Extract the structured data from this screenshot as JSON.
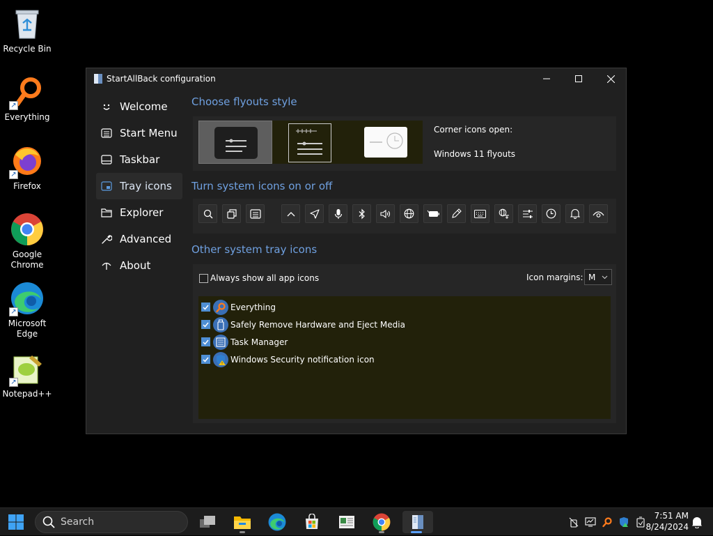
{
  "desktop": {
    "icons": [
      {
        "name": "recycle-bin",
        "label": "Recycle Bin"
      },
      {
        "name": "everything",
        "label": "Everything"
      },
      {
        "name": "firefox",
        "label": "Firefox"
      },
      {
        "name": "google-chrome",
        "label": "Google Chrome"
      },
      {
        "name": "microsoft-edge",
        "label": "Microsoft Edge"
      },
      {
        "name": "notepad-plus-plus",
        "label": "Notepad++"
      }
    ]
  },
  "window": {
    "title": "StartAllBack configuration",
    "nav": [
      {
        "label": "Welcome",
        "icon": "smiley-icon"
      },
      {
        "label": "Start Menu",
        "icon": "start-menu-icon"
      },
      {
        "label": "Taskbar",
        "icon": "taskbar-icon"
      },
      {
        "label": "Tray icons",
        "icon": "tray-icon",
        "active": true
      },
      {
        "label": "Explorer",
        "icon": "folder-icon"
      },
      {
        "label": "Advanced",
        "icon": "wrench-icon"
      },
      {
        "label": "About",
        "icon": "about-icon"
      }
    ],
    "flyouts": {
      "section_title": "Choose flyouts style",
      "corner_label": "Corner icons open:",
      "corner_value": "Windows 11 flyouts"
    },
    "system_icons": {
      "section_title": "Turn system icons on or off",
      "icons": [
        "search-icon",
        "task-view-icon",
        "widgets-icon",
        "chevron-up-icon",
        "location-icon",
        "microphone-icon",
        "bluetooth-icon",
        "volume-icon",
        "globe-icon",
        "battery-icon",
        "pen-icon",
        "keyboard-icon",
        "language-icon",
        "settings-sliders-icon",
        "clock-icon",
        "bell-icon",
        "eye-icon"
      ]
    },
    "other_icons": {
      "section_title": "Other system tray icons",
      "always_show_label": "Always show all app icons",
      "always_show_checked": false,
      "margins_label": "Icon margins:",
      "margins_value": "M",
      "apps": [
        {
          "label": "Everything",
          "checked": true
        },
        {
          "label": "Safely Remove Hardware and Eject Media",
          "checked": true
        },
        {
          "label": "Task Manager",
          "checked": true
        },
        {
          "label": "Windows Security notification icon",
          "checked": true
        }
      ]
    }
  },
  "taskbar": {
    "search_placeholder": "Search",
    "apps": [
      "task-view",
      "file-explorer",
      "edge",
      "store",
      "notepad",
      "chrome",
      "startallback"
    ],
    "time": "7:51 AM",
    "date": "8/24/2024"
  }
}
